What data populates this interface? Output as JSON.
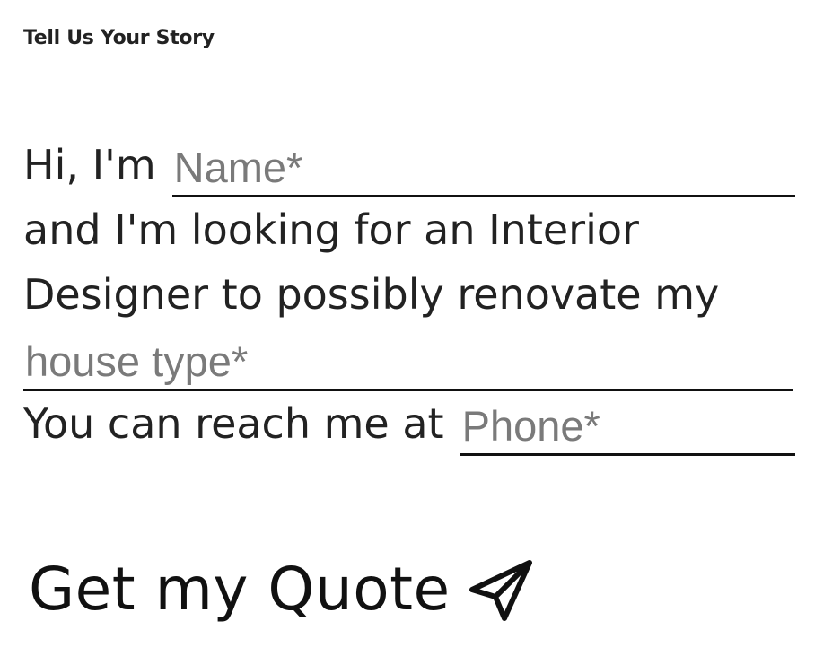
{
  "heading": "Tell Us Your Story",
  "story": {
    "line1_prefix": "Hi, I'm",
    "name_placeholder": "Name*",
    "line2": "and I'm looking for an Interior",
    "line3": "Designer to possibly renovate my",
    "house_type_placeholder": "house type*",
    "line5_prefix": "You can reach me at",
    "phone_placeholder": "Phone*"
  },
  "cta": {
    "label": "Get my Quote",
    "icon": "send-icon"
  }
}
